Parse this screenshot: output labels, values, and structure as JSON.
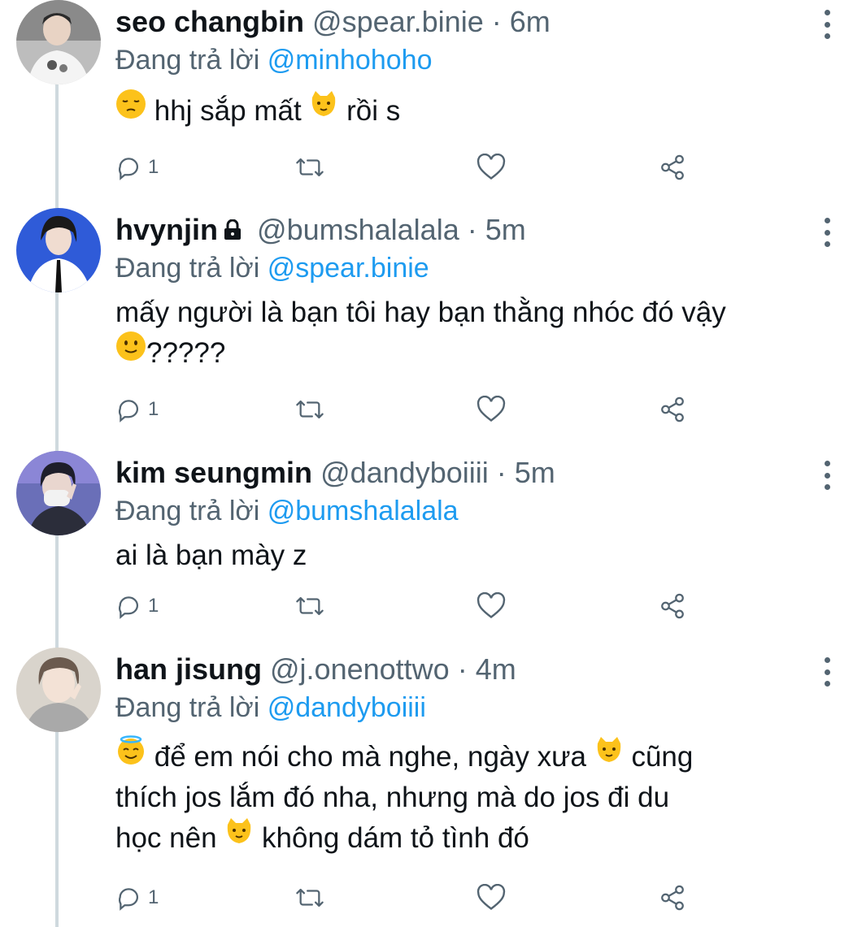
{
  "thread": {
    "replying_prefix": "Đang trả lời",
    "tweets": [
      {
        "name": "seo changbin",
        "handle": "@spear.binie",
        "separator": "·",
        "time": "6m",
        "reply_to": "@minhohoho",
        "lines": [
          "hhj sắp mất",
          "rồi s"
        ],
        "reply_count": "1",
        "locked": false
      },
      {
        "name": "hvynjin",
        "handle": "@bumshalalala",
        "separator": "·",
        "time": "5m",
        "reply_to": "@spear.binie",
        "lines": [
          "mấy người là bạn tôi hay bạn thằng nhóc đó vậy",
          "?????"
        ],
        "reply_count": "1",
        "locked": true
      },
      {
        "name": "kim seungmin",
        "handle": "@dandyboiiii",
        "separator": "·",
        "time": "5m",
        "reply_to": "@bumshalalala",
        "lines": [
          "ai là bạn mày z"
        ],
        "reply_count": "1",
        "locked": false
      },
      {
        "name": "han jisung",
        "handle": "@j.onenottwo",
        "separator": "·",
        "time": "4m",
        "reply_to": "@dandyboiiii",
        "lines": [
          "để em nói cho mà nghe, ngày xưa",
          "cũng",
          "thích jos lắm đó nha, nhưng mà do jos đi du",
          "học nên",
          "không dám tỏ tình đó"
        ],
        "reply_count": "1",
        "locked": false
      }
    ]
  },
  "icons": {
    "reply": "reply-icon",
    "retweet": "retweet-icon",
    "like": "heart-icon",
    "share": "share-icon",
    "more": "more-vertical-icon",
    "lock": "lock-icon"
  },
  "colors": {
    "mention": "#1d9bf0",
    "secondary_text": "#536471",
    "primary_text": "#0f1419",
    "thread_line": "#cfd9de"
  }
}
